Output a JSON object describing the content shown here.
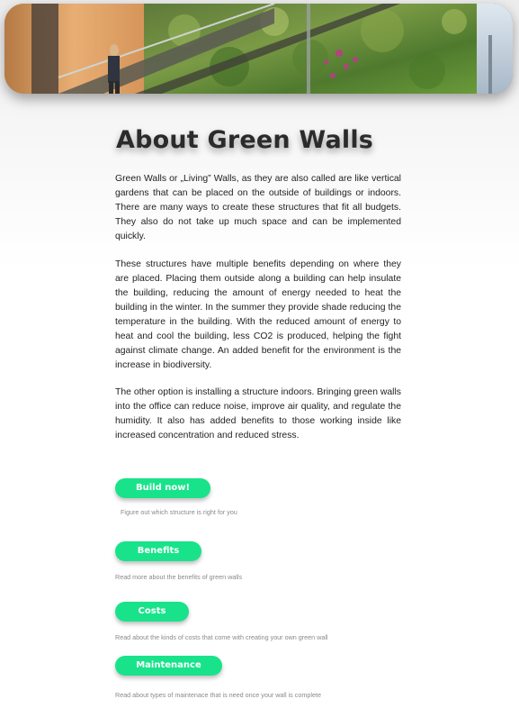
{
  "hero": {
    "alt": "Green wall with staircase"
  },
  "title": "About Green Walls",
  "paragraphs": [
    "Green Walls or „Living” Walls, as they are also called are like vertical gardens that can be placed on the outside of buildings or indoors. There are many ways to create these structures that fit all budgets. They also do not take up much space and can be implemented quickly.",
    "These structures have multiple benefits depending on where they are placed. Placing them outside along a building can help insulate the building, reducing the amount of energy needed to heat the building in the winter. In the summer they provide shade reducing the temperature in the building. With the reduced amount of energy to heat and cool the building, less CO2 is produced, helping the fight against climate change. An added benefit for the environment is the increase in biodiversity.",
    "The other option is installing a structure indoors. Bringing green walls into the office can reduce noise, improve air quality, and regulate the humidity. It also has added benefits to those working inside like increased concentration and reduced stress."
  ],
  "actions": [
    {
      "label": "Build now!",
      "description": "Figure out which structure is right for you"
    },
    {
      "label": "Benefits",
      "description": "Read more about the benefits of green walls"
    },
    {
      "label": "Costs",
      "description": "Read about the kinds of costs that come with creating your own green wall"
    },
    {
      "label": "Maintenance",
      "description": "Read about types of maintenace that is need once your wall is complete"
    }
  ],
  "colors": {
    "accent": "#19e38a",
    "title": "#2b2b2b"
  }
}
